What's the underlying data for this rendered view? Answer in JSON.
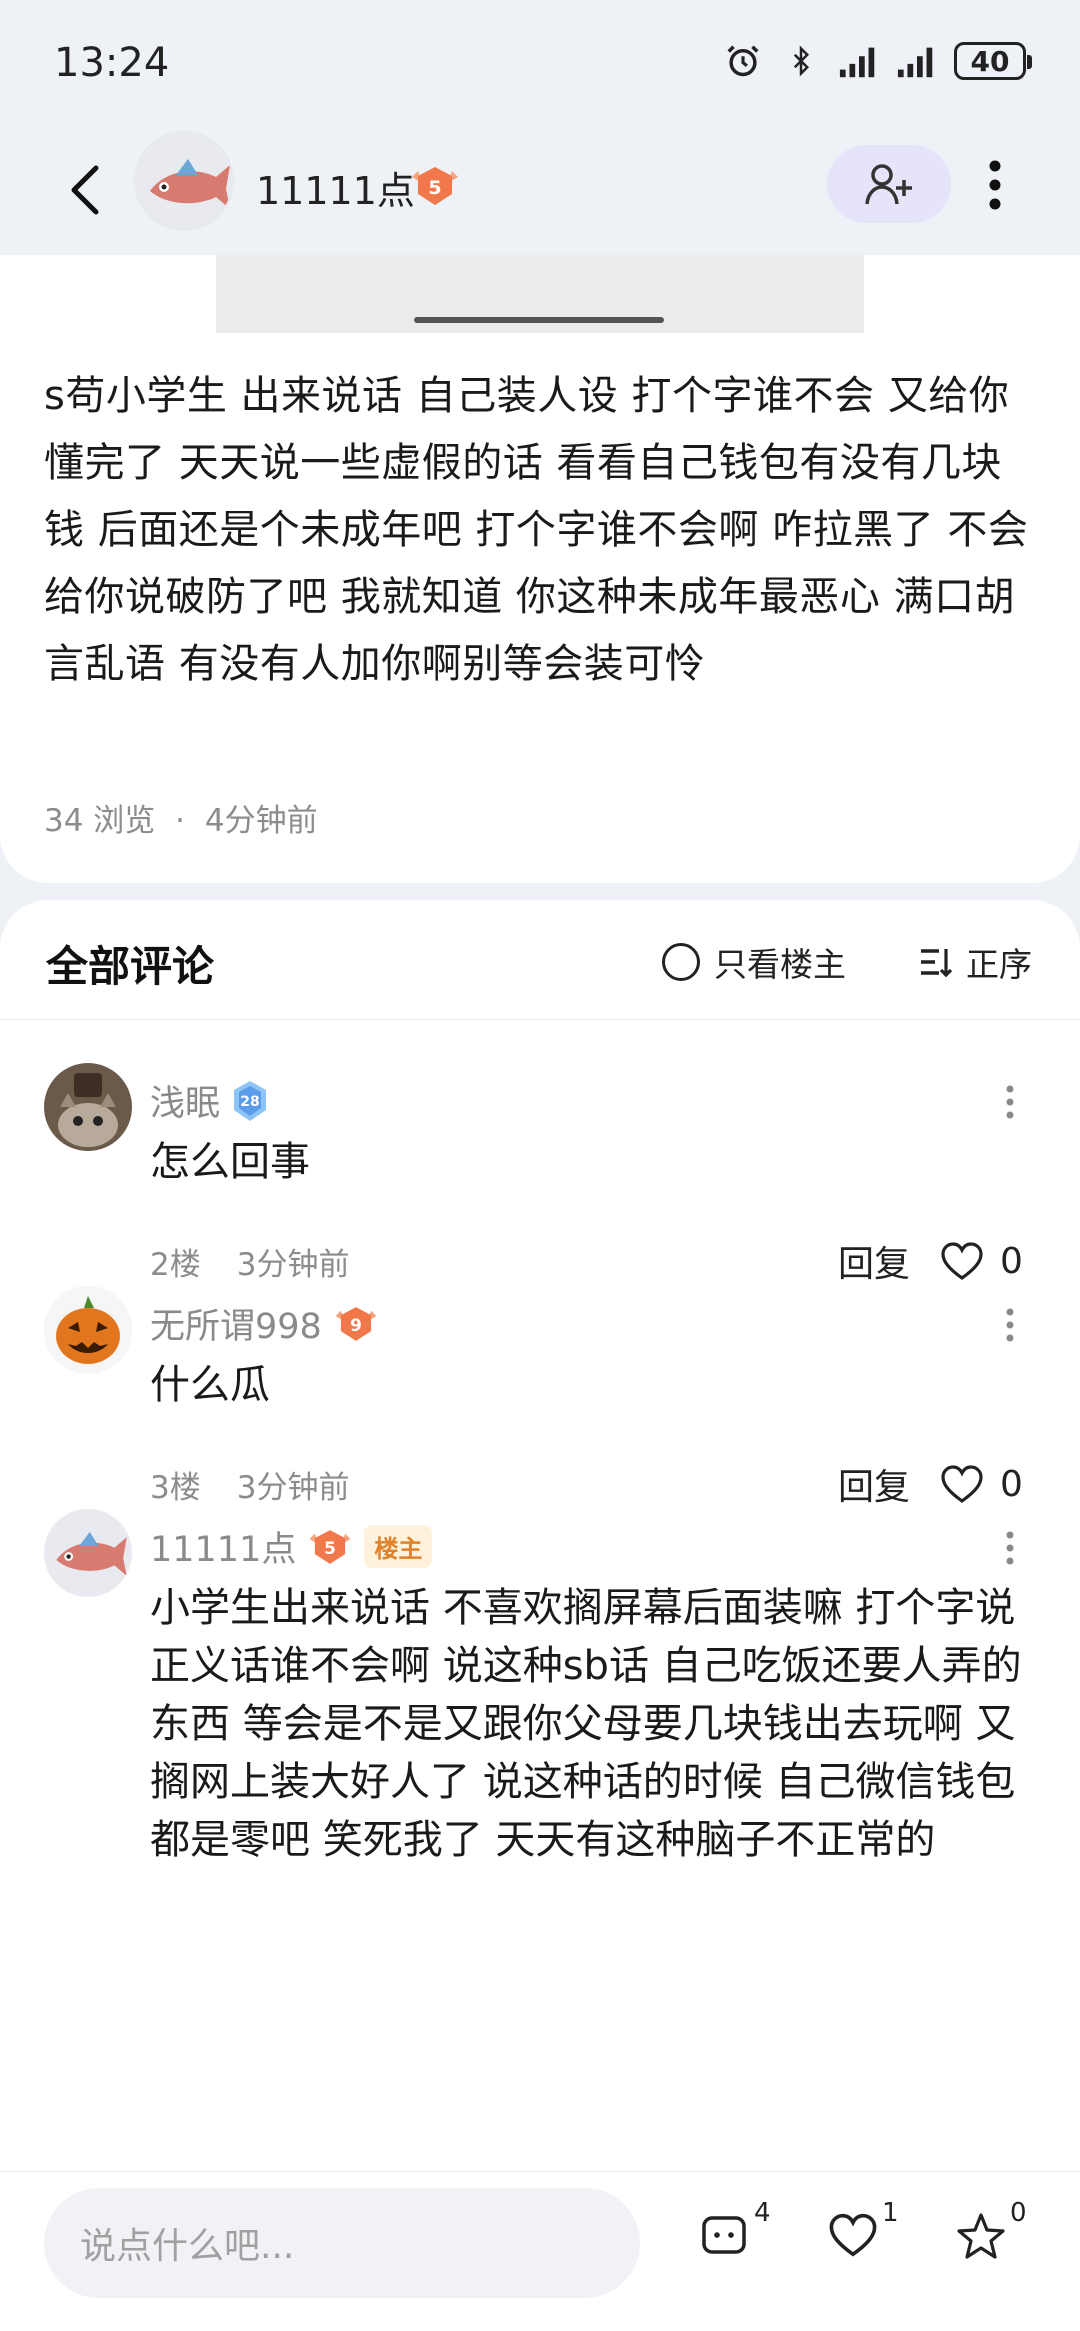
{
  "status_bar": {
    "time": "13:24",
    "battery": "40"
  },
  "header": {
    "username": "11111点",
    "level": "5"
  },
  "post": {
    "text": "s苟小学生 出来说话 自己装人设 打个字谁不会 又给你懂完了 天天说一些虚假的话 看看自己钱包有没有几块钱 后面还是个未成年吧 打个字谁不会啊 咋拉黑了 不会给你说破防了吧 我就知道 你这种未成年最恶心 满口胡言乱语 有没有人加你啊别等会装可怜",
    "views": "34 浏览",
    "separator": "·",
    "time_ago": "4分钟前"
  },
  "comments_header": {
    "title": "全部评论",
    "op_only_label": "只看楼主",
    "sort_label": "正序"
  },
  "comments": [
    {
      "name": "浅眠",
      "level": "28",
      "text": "怎么回事",
      "floor": "2楼",
      "time": "3分钟前",
      "reply_label": "回复",
      "likes": "0"
    },
    {
      "name": "无所谓998",
      "level": "9",
      "text": "什么瓜",
      "floor": "3楼",
      "time": "3分钟前",
      "reply_label": "回复",
      "likes": "0"
    },
    {
      "name": "11111点",
      "level": "5",
      "op_tag": "楼主",
      "text": "小学生出来说话 不喜欢搁屏幕后面装嘛 打个字说正义话谁不会啊 说这种sb话 自己吃饭还要人弄的东西 等会是不是又跟你父母要几块钱出去玩啊 又搁网上装大好人了 说这种话的时候 自己微信钱包都是零吧 笑死我了 天天有这种脑子不正常的"
    }
  ],
  "bottom_bar": {
    "input_placeholder": "说点什么吧...",
    "comment_count": "4",
    "like_count": "1",
    "favorite_count": "0"
  },
  "colors": {
    "page_bg": "#eef1f6",
    "follow_bg": "#e5e4fb",
    "level_orange": "#f0784a",
    "level_blue": "#5a9bea",
    "op_tag_text": "#e0822a"
  }
}
